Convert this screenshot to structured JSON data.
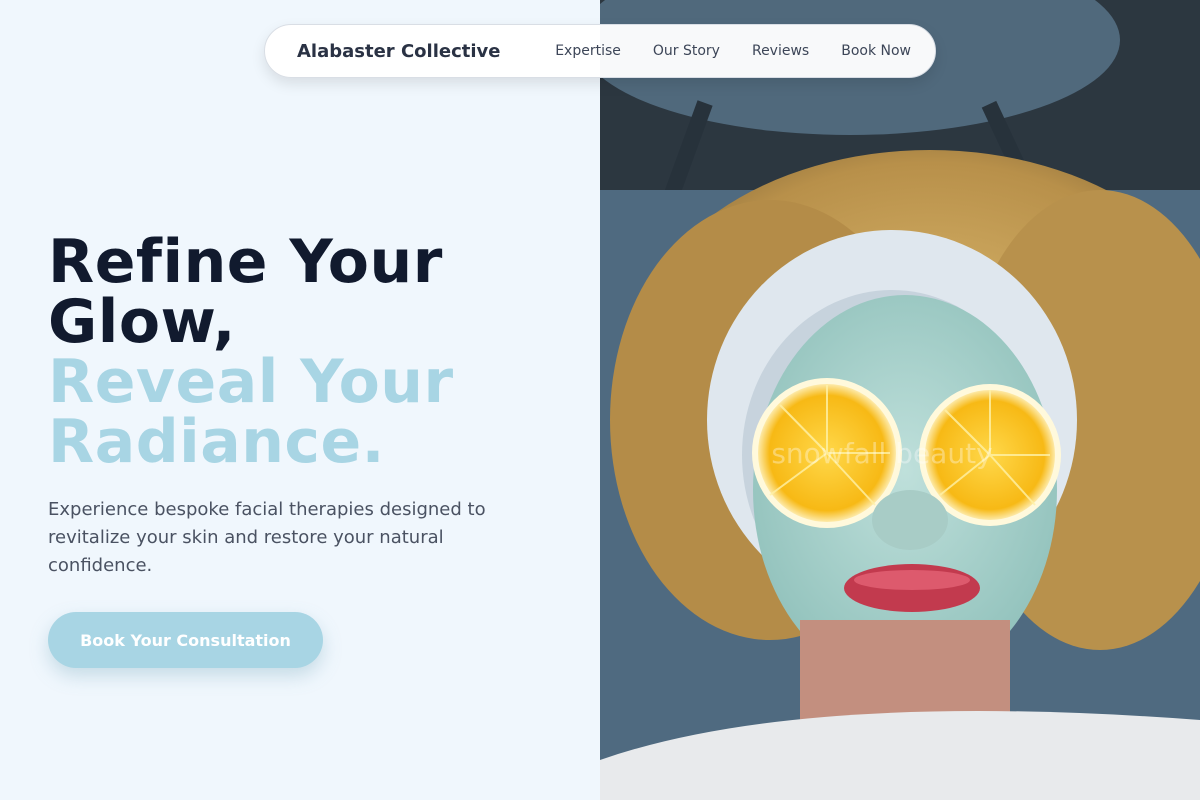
{
  "nav": {
    "brand": "Alabaster Collective",
    "links": [
      "Expertise",
      "Our Story",
      "Reviews",
      "Book Now"
    ]
  },
  "hero": {
    "title_lines_dark": [
      "Refine Your",
      "Glow,"
    ],
    "title_lines_accent": [
      "Reveal Your",
      "Radiance."
    ],
    "description": "Experience bespoke facial therapies designed to revitalize your skin and restore your natural confidence.",
    "cta_label": "Book Your Consultation"
  },
  "image": {
    "watermark": "snowfall beauty"
  },
  "colors": {
    "background": "#f0f7fd",
    "heading_dark": "#111a2e",
    "accent": "#a8d5e4",
    "body_text": "#4a5262"
  }
}
